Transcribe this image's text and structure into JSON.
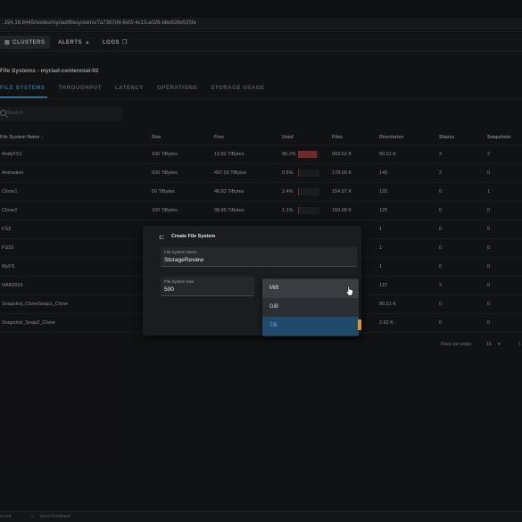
{
  "browser": {
    "url": ".194.16:8445/nodes/myriad/filesystems/7a7367d4-8ef3-4c13-a026-bbe628e535fe"
  },
  "nav": {
    "clusters": "CLUSTERS",
    "alerts": "ALERTS",
    "logs": "LOGS",
    "icons": [
      "cluster-icon",
      "alert-icon",
      "logs-icon"
    ]
  },
  "page": {
    "title": "File Systems - myriad-centennial-02"
  },
  "subtabs": [
    "FILE SYSTEMS",
    "THROUGHPUT",
    "LATENCY",
    "OPERATIONS",
    "STORAGE USAGE"
  ],
  "search": {
    "placeholder": "Search"
  },
  "table": {
    "headers": [
      "File System Name ↑",
      "Size",
      "Free",
      "Used",
      "Files",
      "Directories",
      "Shares",
      "Snapshots"
    ],
    "rows": [
      {
        "name": "AndyFS1",
        "size": "100 TiBytes",
        "free": "13.82 TiBytes",
        "used": "86.2%",
        "used_fraction": 0.862,
        "files": "903.62 K",
        "dirs": "80.01 K",
        "shares": "3",
        "snapshots": "2"
      },
      {
        "name": "Animation",
        "size": "500 TiBytes",
        "free": "497.53 TiBytes",
        "used": "0.5%",
        "used_fraction": 0.005,
        "files": "178.00 K",
        "dirs": "145",
        "shares": "2",
        "snapshots": "0"
      },
      {
        "name": "Clone1",
        "size": "50 TiBytes",
        "free": "48.82 TiBytes",
        "used": "2.4%",
        "used_fraction": 0.024,
        "files": "154.97 K",
        "dirs": "125",
        "shares": "0",
        "snapshots": "1"
      },
      {
        "name": "Clone2",
        "size": "100 TiBytes",
        "free": "98.85 TiBytes",
        "used": "1.1%",
        "used_fraction": 0.011,
        "files": "150.68 K",
        "dirs": "125",
        "shares": "0",
        "snapshots": "0"
      },
      {
        "name": "FS3",
        "size": "",
        "free": "",
        "used": "",
        "used_fraction": null,
        "files": "",
        "dirs": "1",
        "shares": "0",
        "snapshots": "0"
      },
      {
        "name": "FS33",
        "size": "",
        "free": "",
        "used": "",
        "used_fraction": null,
        "files": "",
        "dirs": "1",
        "shares": "0",
        "snapshots": "0"
      },
      {
        "name": "MyFS",
        "size": "",
        "free": "",
        "used": "",
        "used_fraction": null,
        "files": "",
        "dirs": "1",
        "shares": "0",
        "snapshots": "0"
      },
      {
        "name": "NAB2024",
        "size": "",
        "free": "",
        "used": "",
        "used_fraction": null,
        "files": "",
        "dirs": "137",
        "shares": "2",
        "snapshots": "0"
      },
      {
        "name": "Snapshot_CloneSnap1_Clone",
        "size": "",
        "free": "",
        "used": "",
        "used_fraction": null,
        "files": "",
        "dirs": "80.01 K",
        "shares": "0",
        "snapshots": "0"
      },
      {
        "name": "Snapshot_Snap2_Clone",
        "size": "",
        "free": "",
        "used": "",
        "used_fraction": null,
        "files": "",
        "dirs": "2.62 K",
        "shares": "0",
        "snapshots": "0"
      }
    ]
  },
  "pagination": {
    "label": "Rows per page:",
    "value": "10",
    "range": "1"
  },
  "dialog": {
    "title": "Create File System",
    "name_label": "File System Name",
    "name_value": "StorageReview",
    "size_label": "File System Size",
    "size_value": "500",
    "unit_options": [
      "MiB",
      "GiB",
      "TiB"
    ],
    "unit_selected": "TiB",
    "unit_hovered": "MiB"
  },
  "footer": {
    "left": "erved",
    "feedback": "Send Feedback"
  },
  "colors": {
    "accent": "#4ea3d9",
    "used_bar": "#b04040",
    "selected_option": "#1f4a6a",
    "orange": "#e8922a"
  }
}
